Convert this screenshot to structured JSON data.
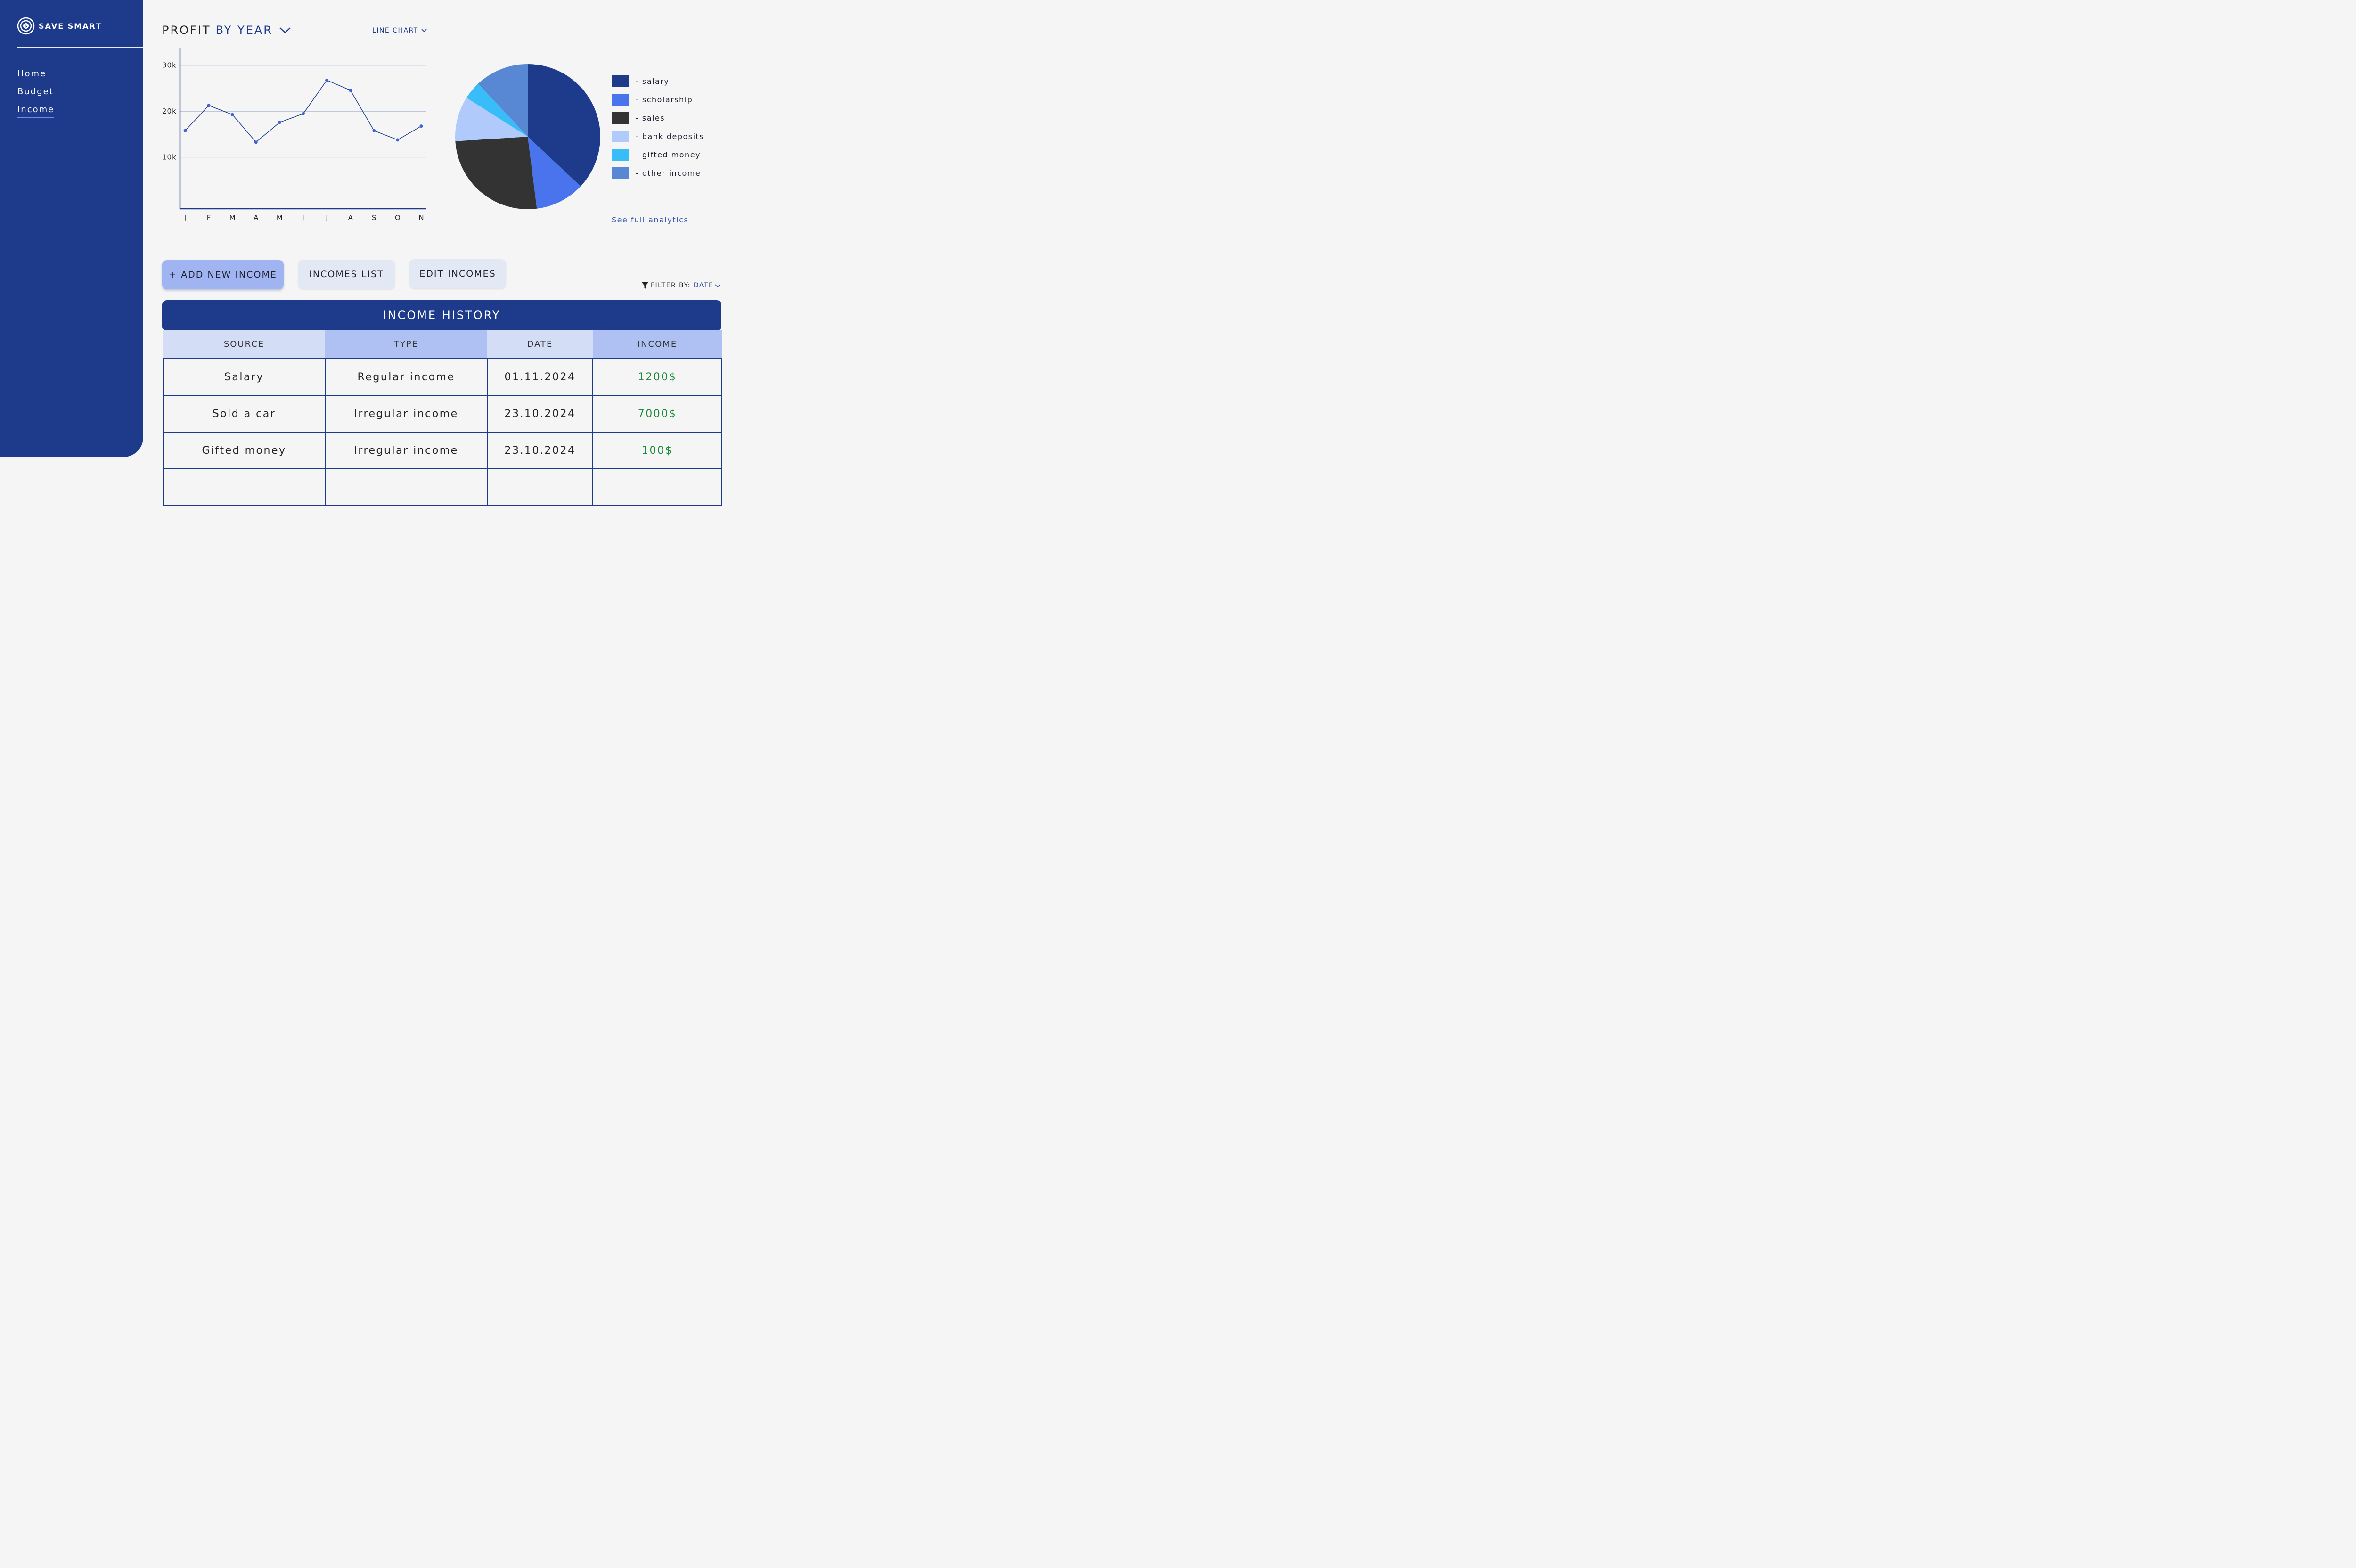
{
  "app": {
    "name": "SAVE SMART"
  },
  "sidebar": {
    "items": [
      {
        "label": "Home",
        "active": false
      },
      {
        "label": "Budget",
        "active": false
      },
      {
        "label": "Income",
        "active": true
      }
    ]
  },
  "chart_header": {
    "title": "PROFIT",
    "period": "BY YEAR",
    "chart_type": "LINE CHART"
  },
  "chart_data": [
    {
      "type": "line",
      "title": "",
      "xlabel": "",
      "ylabel": "",
      "x": [
        "J",
        "F",
        "M",
        "A",
        "M",
        "J",
        "J",
        "A",
        "S",
        "O",
        "N"
      ],
      "values": [
        17000,
        22500,
        20500,
        14500,
        18800,
        20700,
        28000,
        25800,
        17000,
        15000,
        18000
      ],
      "yticks": [
        "10k",
        "20k",
        "30k"
      ],
      "ylim": [
        0,
        35000
      ],
      "grid": true,
      "color": "#1e3a8a",
      "point_color": "#3f63d8"
    },
    {
      "type": "pie",
      "title": "",
      "slices": [
        {
          "label": "- salary",
          "value": 37,
          "color": "#1e3a8a"
        },
        {
          "label": "- scholarship",
          "value": 11,
          "color": "#4a74ee"
        },
        {
          "label": "- sales",
          "value": 26,
          "color": "#333333"
        },
        {
          "label": "- bank deposits",
          "value": 10,
          "color": "#b0cbfb"
        },
        {
          "label": "- gifted money",
          "value": 4,
          "color": "#38bdf8"
        },
        {
          "label": "- other income",
          "value": 12,
          "color": "#5888d4"
        }
      ],
      "legend_position": "right"
    }
  ],
  "analytics_link": "See full analytics",
  "buttons": {
    "add": "+ ADD NEW INCOME",
    "list": "INCOMES LIST",
    "edit": "EDIT INCOMES"
  },
  "filter": {
    "label": "FILTER BY:",
    "value": "DATE"
  },
  "table": {
    "title": "INCOME HISTORY",
    "columns": [
      "SOURCE",
      "TYPE",
      "DATE",
      "INCOME"
    ],
    "rows": [
      {
        "source": "Salary",
        "type": "Regular income",
        "date": "01.11.2024",
        "income": "1200$"
      },
      {
        "source": "Sold a car",
        "type": "Irregular income",
        "date": "23.10.2024",
        "income": "7000$"
      },
      {
        "source": "Gifted money",
        "type": "Irregular income",
        "date": "23.10.2024",
        "income": "100$"
      },
      {
        "source": "",
        "type": "",
        "date": "",
        "income": ""
      }
    ]
  }
}
